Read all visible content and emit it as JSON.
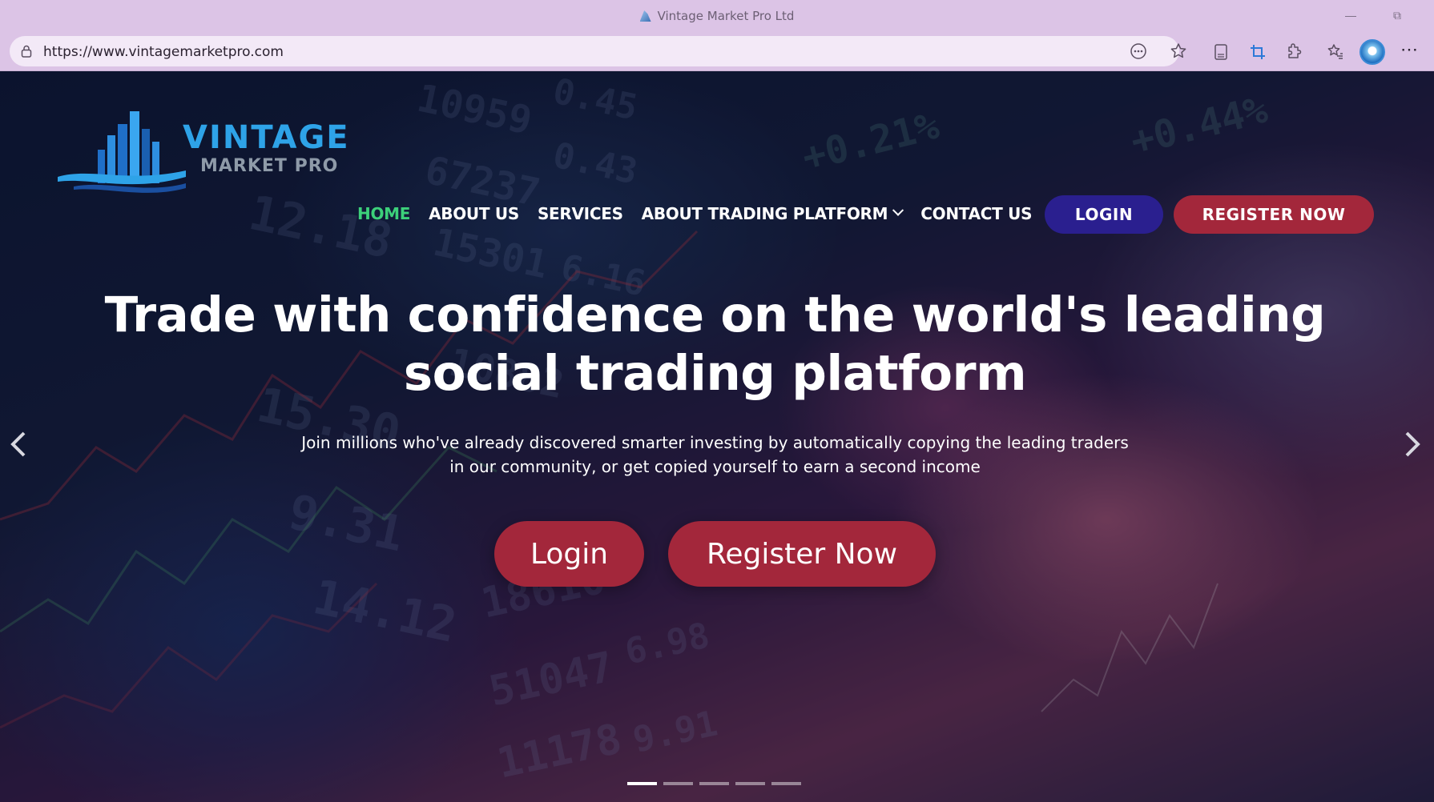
{
  "browser": {
    "window_title": "Vintage Market Pro Ltd",
    "url": "https://www.vintagemarketpro.com"
  },
  "logo": {
    "line1": "VINTAGE",
    "line2": "MARKET PRO"
  },
  "nav": {
    "items": [
      {
        "label": "HOME",
        "active": true
      },
      {
        "label": "ABOUT US",
        "active": false
      },
      {
        "label": "SERVICES",
        "active": false
      },
      {
        "label": "ABOUT TRADING PLATFORM",
        "active": false,
        "dropdown": true
      },
      {
        "label": "CONTACT US",
        "active": false
      }
    ],
    "login_label": "LOGIN",
    "register_label": "REGISTER NOW"
  },
  "hero": {
    "headline": "Trade with confidence on the world's leading social trading platform",
    "subtext": "Join millions who've already discovered smarter investing by automatically copying the leading traders in our community, or get copied yourself to earn a second income",
    "login_label": "Login",
    "register_label": "Register Now",
    "slides_total": 5,
    "active_slide": 1
  },
  "colors": {
    "nav_active": "#3cd07a",
    "login_button": "#2a1f8f",
    "register_button": "#a3273b",
    "logo_primary": "#2ea3e8"
  }
}
